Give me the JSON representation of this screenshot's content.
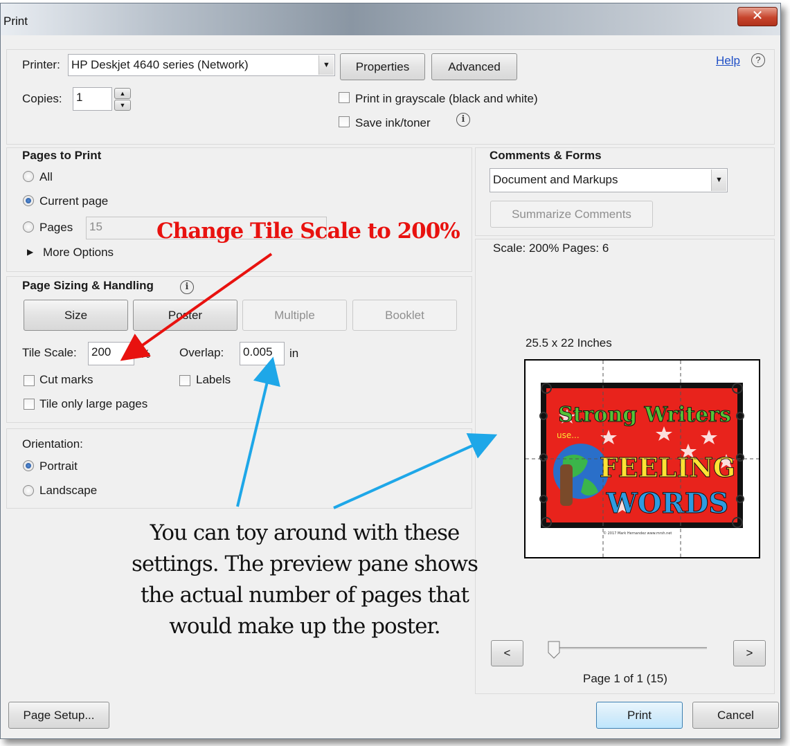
{
  "window": {
    "title": "Print",
    "close_icon": "close-x-icon"
  },
  "printer": {
    "label": "Printer:",
    "value": "HP Deskjet 4640 series (Network)",
    "properties_label": "Properties",
    "advanced_label": "Advanced",
    "help_label": "Help"
  },
  "copies": {
    "label": "Copies:",
    "value": "1"
  },
  "options": {
    "grayscale_label": "Print in grayscale (black and white)",
    "save_ink_label": "Save ink/toner"
  },
  "pages_to_print": {
    "heading": "Pages to Print",
    "all_label": "All",
    "current_label": "Current page",
    "pages_label": "Pages",
    "pages_value": "15",
    "more_options_label": "More Options",
    "selected": "Current page"
  },
  "page_sizing": {
    "heading": "Page Sizing & Handling",
    "tabs": [
      "Size",
      "Poster",
      "Multiple",
      "Booklet"
    ],
    "tile_scale_label": "Tile Scale:",
    "tile_scale_value": "200",
    "percent_sign": "%",
    "overlap_label": "Overlap:",
    "overlap_value": "0.005",
    "overlap_unit": "in",
    "cut_marks_label": "Cut marks",
    "labels_label": "Labels",
    "tile_large_label": "Tile only large pages"
  },
  "orientation": {
    "label": "Orientation:",
    "portrait_label": "Portrait",
    "landscape_label": "Landscape",
    "selected": "Portrait"
  },
  "comments_forms": {
    "heading": "Comments & Forms",
    "value": "Document and Markups",
    "summarize_label": "Summarize Comments"
  },
  "preview": {
    "scale_text": "Scale: 200% Pages: 6",
    "size_text": "25.5 x 22 Inches",
    "poster_line1": "Strong Writers",
    "poster_use": "use...",
    "poster_line2": "FEELING",
    "poster_line3": "WORDS",
    "poster_footer": "© 2017 Mark Hernandez  www.mrsh.net",
    "prev_label": "<",
    "next_label": ">",
    "page_indicator": "Page 1 of 1 (15)",
    "slider_position": 0
  },
  "footer": {
    "page_setup_label": "Page Setup...",
    "print_label": "Print",
    "cancel_label": "Cancel"
  },
  "annotations": {
    "red_note": "Change Tile Scale to 200%",
    "black_note": [
      "You can toy around with these",
      "settings. The preview pane shows",
      "the actual number of pages that",
      "would make up the poster."
    ],
    "red_color": "#e8120f",
    "blue_color": "#1ea7e8"
  }
}
